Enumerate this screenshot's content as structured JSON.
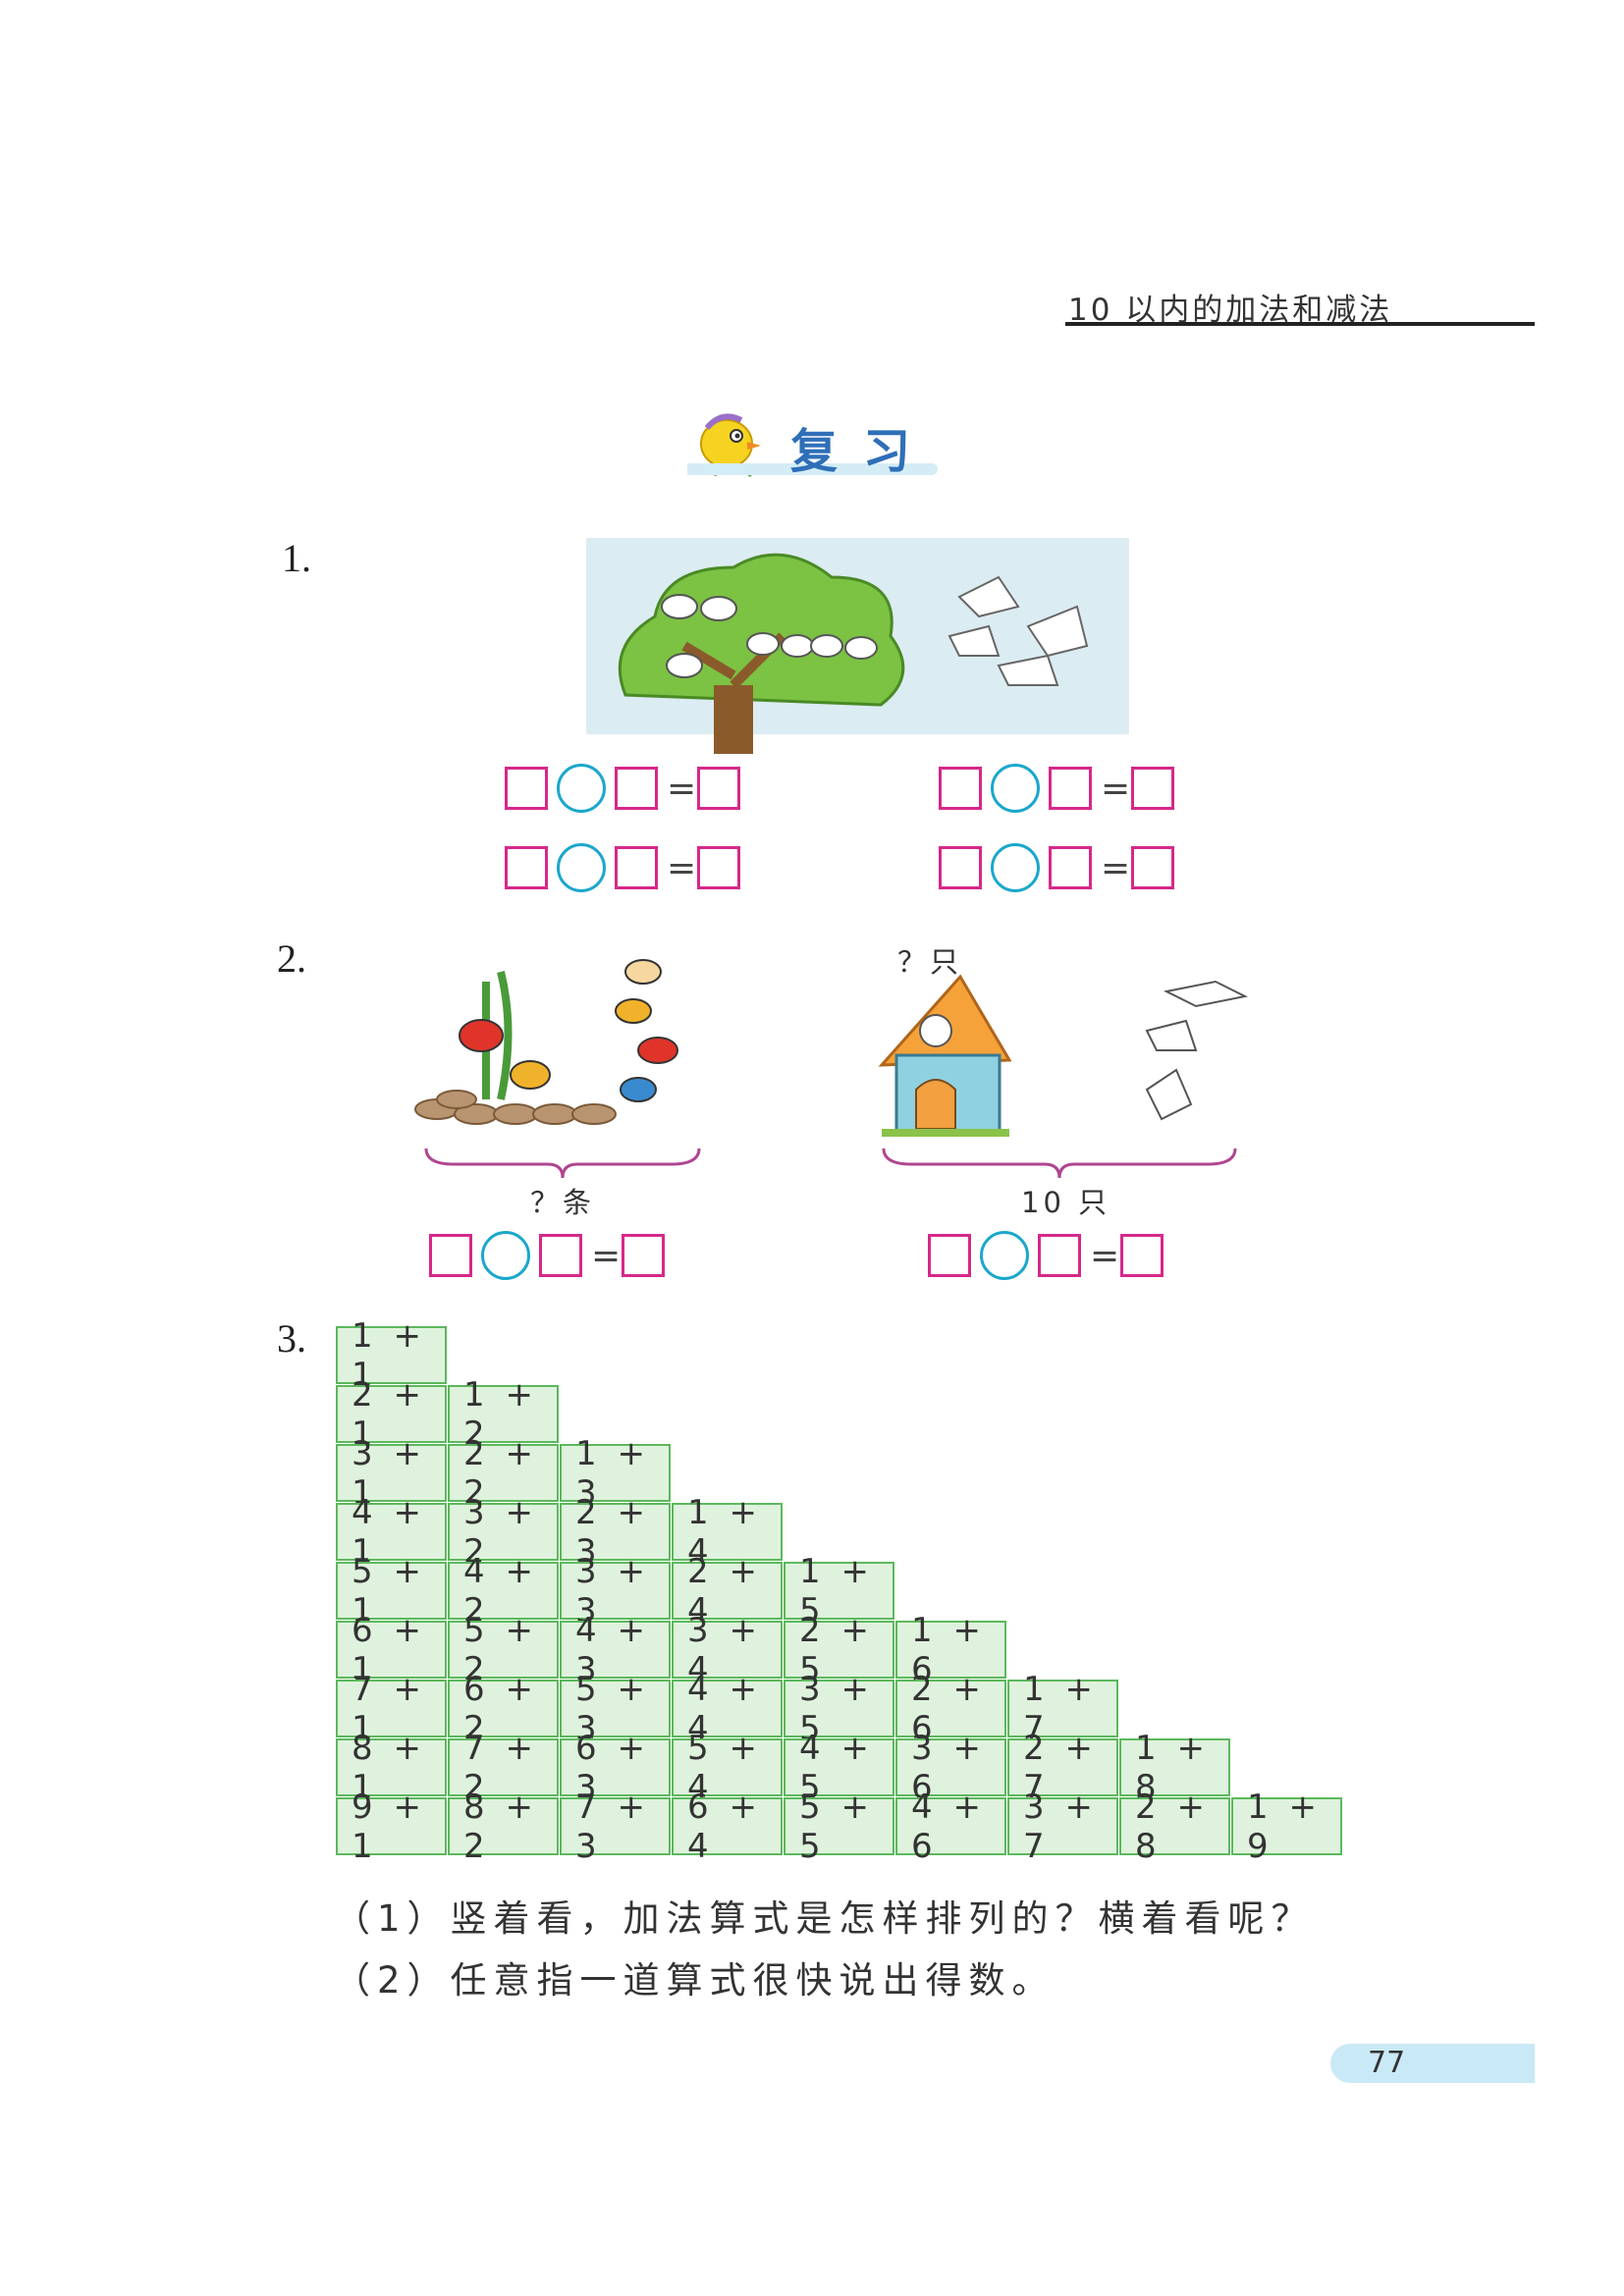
{
  "header": {
    "chapter_title": "10 以内的加法和减法"
  },
  "section": {
    "title": "复习",
    "icon": "chick-mascot-icon"
  },
  "q1": {
    "number": "1.",
    "picture": "birds-tree-illustration",
    "rows": [
      [
        "□",
        "○",
        "□",
        "=",
        "□"
      ],
      [
        "□",
        "○",
        "□",
        "=",
        "□"
      ]
    ]
  },
  "q2": {
    "number": "2.",
    "left": {
      "caption": "？条",
      "picture": "goldfish-illustration"
    },
    "right": {
      "top_caption": "？只",
      "caption": "10 只",
      "picture": "house-doves-illustration"
    }
  },
  "q3": {
    "number": "3.",
    "table": [
      [
        "1 + 1"
      ],
      [
        "2 + 1",
        "1 + 2"
      ],
      [
        "3 + 1",
        "2 + 2",
        "1 + 3"
      ],
      [
        "4 + 1",
        "3 + 2",
        "2 + 3",
        "1 + 4"
      ],
      [
        "5 + 1",
        "4 + 2",
        "3 + 3",
        "2 + 4",
        "1 + 5"
      ],
      [
        "6 + 1",
        "5 + 2",
        "4 + 3",
        "3 + 4",
        "2 + 5",
        "1 + 6"
      ],
      [
        "7 + 1",
        "6 + 2",
        "5 + 3",
        "4 + 4",
        "3 + 5",
        "2 + 6",
        "1 + 7"
      ],
      [
        "8 + 1",
        "7 + 2",
        "6 + 3",
        "5 + 4",
        "4 + 5",
        "3 + 6",
        "2 + 7",
        "1 + 8"
      ],
      [
        "9 + 1",
        "8 + 2",
        "7 + 3",
        "6 + 4",
        "5 + 5",
        "4 + 6",
        "3 + 7",
        "2 + 8",
        "1 + 9"
      ]
    ],
    "sub1": "（1）竖着看，加法算式是怎样排列的？横着看呢？",
    "sub2": "（2）任意指一道算式很快说出得数。"
  },
  "page_number": "77"
}
